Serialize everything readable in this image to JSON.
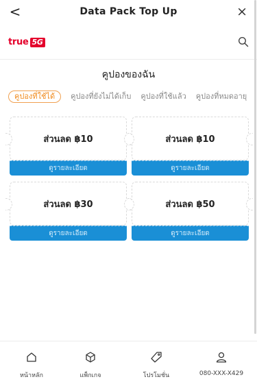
{
  "header": {
    "title": "Data Pack Top Up",
    "back_glyph": "<",
    "close_glyph": "×"
  },
  "brand": {
    "logo_text": "true",
    "logo_badge": "5G",
    "logo_color": "#e4002b",
    "search_icon": "search-icon"
  },
  "page": {
    "heading": "คูปองของฉัน"
  },
  "tabs": [
    {
      "label": "คูปองที่ใช้ได้",
      "active": true
    },
    {
      "label": "คูปองที่ยังไม่ได้เก็บ",
      "active": false
    },
    {
      "label": "คูปองที่ใช้แล้ว",
      "active": false
    },
    {
      "label": "คูปองที่หมดอายุ",
      "active": false
    }
  ],
  "coupons": [
    {
      "amount": "ส่วนลด ฿10",
      "button": "ดูรายละเอียด"
    },
    {
      "amount": "ส่วนลด ฿10",
      "button": "ดูรายละเอียด"
    },
    {
      "amount": "ส่วนลด ฿30",
      "button": "ดูรายละเอียด"
    },
    {
      "amount": "ส่วนลด ฿50",
      "button": "ดูรายละเอียด"
    }
  ],
  "bottom_nav": [
    {
      "label": "หน้าหลัก",
      "icon": "home-icon"
    },
    {
      "label": "แพ็กเกจ",
      "icon": "package-icon"
    },
    {
      "label": "โปรโมชั่น",
      "icon": "promotion-tag-icon"
    },
    {
      "label": "080-XXX-X429",
      "icon": "user-icon"
    }
  ],
  "colors": {
    "accent": "#1a8fd6",
    "active_tab": "#f08a1c",
    "brand_red": "#e4002b"
  }
}
